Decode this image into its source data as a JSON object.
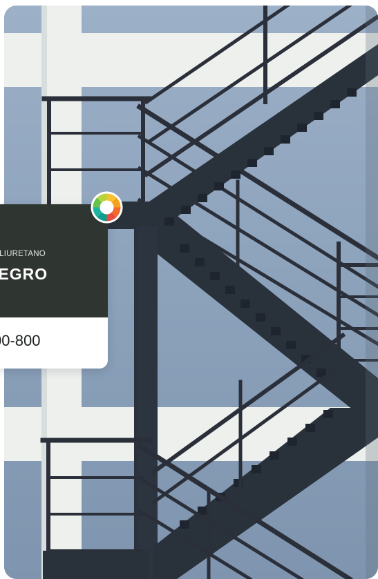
{
  "swatch": {
    "product_type_visible": "OLIURETANO",
    "color_name_visible": "IEGRO",
    "code_visible": "00-800",
    "color_hex": "#2f3531"
  },
  "icons": {
    "color_wheel": "color-wheel-icon"
  }
}
